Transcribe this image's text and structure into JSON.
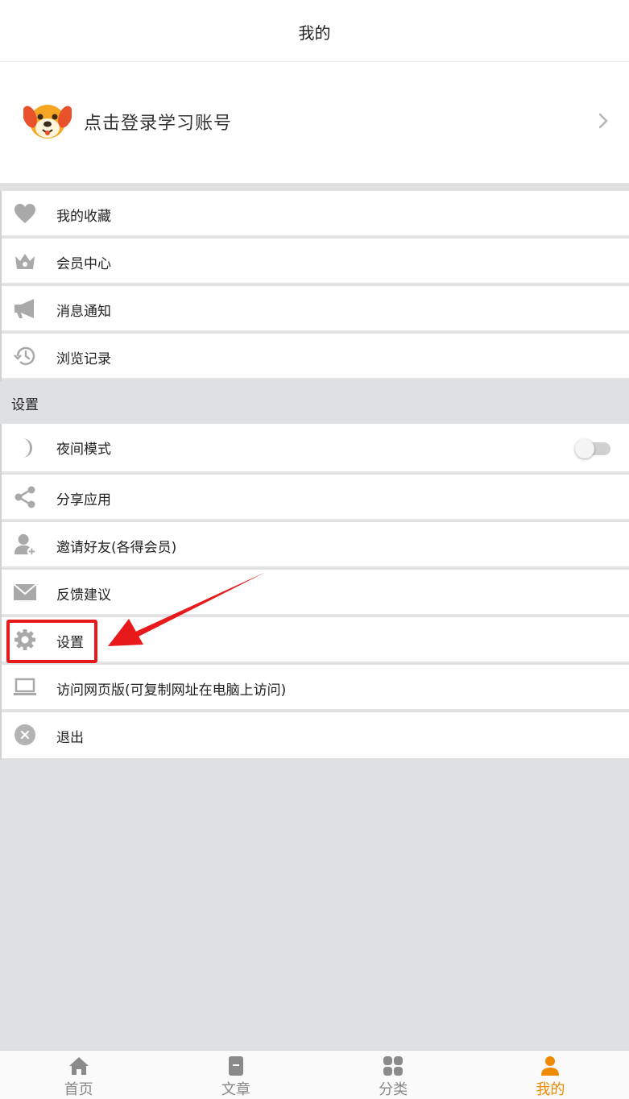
{
  "header": {
    "title": "我的"
  },
  "profile": {
    "login_text": "点击登录学习账号"
  },
  "menu": [
    {
      "label": "我的收藏",
      "icon": "heart-icon"
    },
    {
      "label": "会员中心",
      "icon": "crown-icon"
    },
    {
      "label": "消息通知",
      "icon": "megaphone-icon"
    },
    {
      "label": "浏览记录",
      "icon": "history-icon"
    }
  ],
  "settings_section": {
    "title": "设置",
    "items": [
      {
        "label": "夜间模式",
        "icon": "moon-icon",
        "toggle": "off"
      },
      {
        "label": "分享应用",
        "icon": "share-icon"
      },
      {
        "label": "邀请好友(各得会员)",
        "icon": "add-user-icon"
      },
      {
        "label": "反馈建议",
        "icon": "mail-icon"
      },
      {
        "label": "设置",
        "icon": "gear-icon"
      },
      {
        "label": "访问网页版(可复制网址在电脑上访问)",
        "icon": "laptop-icon"
      },
      {
        "label": "退出",
        "icon": "close-circle-icon"
      }
    ]
  },
  "tabbar": {
    "tabs": [
      {
        "label": "首页",
        "icon": "home-icon"
      },
      {
        "label": "文章",
        "icon": "document-icon"
      },
      {
        "label": "分类",
        "icon": "grid-icon"
      },
      {
        "label": "我的",
        "icon": "user-icon",
        "active": true
      }
    ]
  },
  "colors": {
    "accent": "#f08a00",
    "highlight": "#e8191b",
    "icon_gray": "#a9a9a9"
  }
}
